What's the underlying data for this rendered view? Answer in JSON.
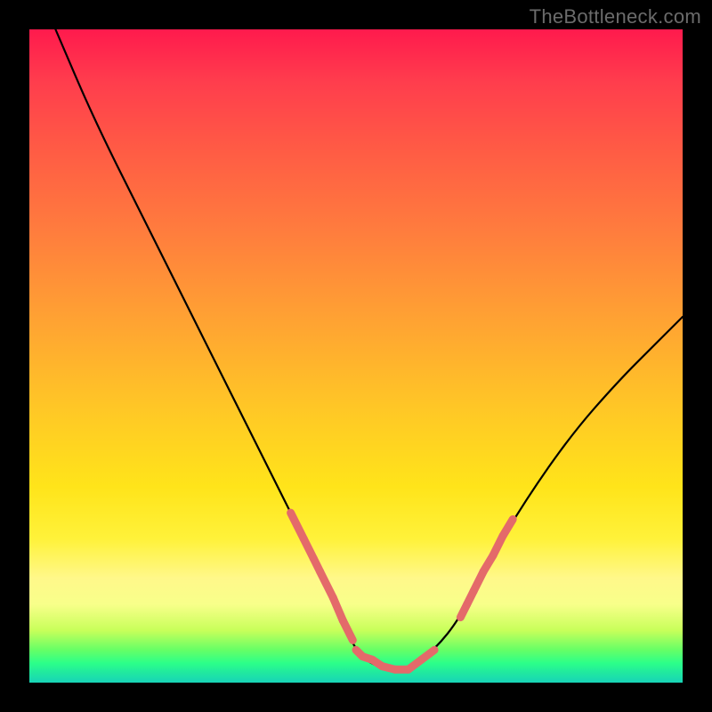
{
  "watermark": "TheBottleneck.com",
  "colors": {
    "background": "#000000",
    "gradient_top": "#ff1a4d",
    "gradient_mid": "#ffe41a",
    "gradient_bottom": "#18d4b8",
    "curve": "#000000",
    "markers": "#e46a6a"
  },
  "chart_data": {
    "type": "line",
    "title": "",
    "xlabel": "",
    "ylabel": "",
    "xlim": [
      0,
      100
    ],
    "ylim": [
      0,
      100
    ],
    "series": [
      {
        "name": "curve",
        "x": [
          4,
          10,
          18,
          26,
          34,
          40,
          45,
          48,
          50,
          52,
          55,
          58,
          62,
          66,
          70,
          76,
          83,
          90,
          96,
          100
        ],
        "y": [
          100,
          86,
          70,
          54,
          38,
          26,
          16,
          9,
          5,
          3,
          2,
          2,
          5,
          10,
          18,
          28,
          38,
          46,
          52,
          56
        ]
      }
    ],
    "annotations": {
      "valley_marker_segments": [
        {
          "x": [
            40,
            42,
            43.5,
            44.5,
            46.5,
            48,
            49.5
          ],
          "y": [
            26,
            22,
            19,
            17,
            13,
            9.5,
            6.5
          ]
        },
        {
          "x": [
            50,
            51,
            52.5,
            54,
            56,
            58,
            60,
            62
          ],
          "y": [
            5,
            4,
            3.5,
            2.5,
            2,
            2,
            3.5,
            5
          ]
        },
        {
          "x": [
            66,
            67,
            68,
            69.5,
            71,
            72.5,
            74
          ],
          "y": [
            10,
            12,
            14,
            17,
            19.5,
            22.5,
            25
          ]
        }
      ]
    }
  }
}
